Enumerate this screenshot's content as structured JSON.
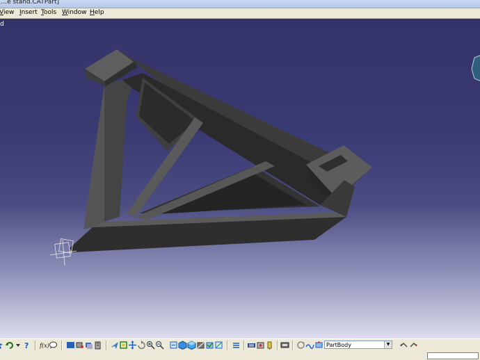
{
  "window": {
    "title": "[...e stand.CATPart]"
  },
  "menu": {
    "items": [
      {
        "label": "View",
        "accel": "V"
      },
      {
        "label": "Insert",
        "accel": "I"
      },
      {
        "label": "Tools",
        "accel": "T"
      },
      {
        "label": "Window",
        "accel": "W"
      },
      {
        "label": "Help",
        "accel": "H"
      }
    ]
  },
  "tree": {
    "label": "d"
  },
  "viewport": {
    "background_top": "#34346a",
    "background_bottom": "#dcdcec",
    "part_color": "#4a4a4a"
  },
  "toolbar": {
    "icons": [
      "select-icon",
      "undo-icon",
      "undo-dropdown-icon",
      "whats-this-icon",
      "formula-icon",
      "comment-icon",
      "specification-tree-icon",
      "hide-show-icon",
      "swap-icon",
      "measure-icon",
      "fly-mode-icon",
      "fit-all-icon",
      "pan-icon",
      "rotate-icon",
      "zoom-in-icon",
      "zoom-out-icon",
      "normal-view-icon",
      "iso-view-icon",
      "shading-icon",
      "hide-icon",
      "swap-visible-icon",
      "create-axis-icon",
      "publish-icon",
      "parameters-icon",
      "snapshot-icon",
      "analysis-icon",
      "knowledge-icon",
      "update-icon",
      "scan-icon"
    ],
    "body_select_value": "PartBody"
  },
  "statusbar": {
    "command_input_value": ""
  }
}
